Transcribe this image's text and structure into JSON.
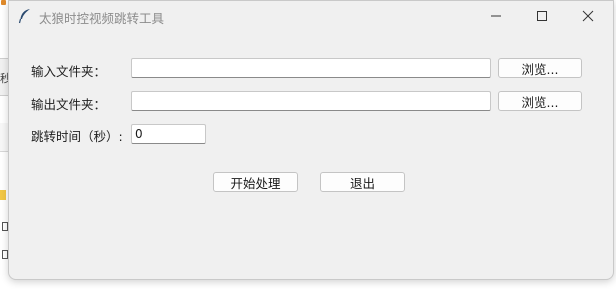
{
  "window": {
    "title": "太狼时控视频跳转工具"
  },
  "form": {
    "input_folder": {
      "label": "输入文件夹：",
      "value": "",
      "browse_label": "浏览..."
    },
    "output_folder": {
      "label": "输出文件夹：",
      "value": "",
      "browse_label": "浏览..."
    },
    "jump_time": {
      "label": "跳转时间（秒）:",
      "value": "0"
    }
  },
  "actions": {
    "start_label": "开始处理",
    "exit_label": "退出"
  },
  "background": {
    "partial_char": "秒"
  },
  "icons": {
    "app": "feather-icon",
    "minimize": "minimize-icon",
    "maximize": "maximize-icon",
    "close": "close-icon"
  },
  "colors": {
    "window_bg": "#f0f0f0",
    "title_text": "#8c8c8c",
    "input_bg": "#ffffff",
    "button_bg": "#fdfdfd"
  }
}
